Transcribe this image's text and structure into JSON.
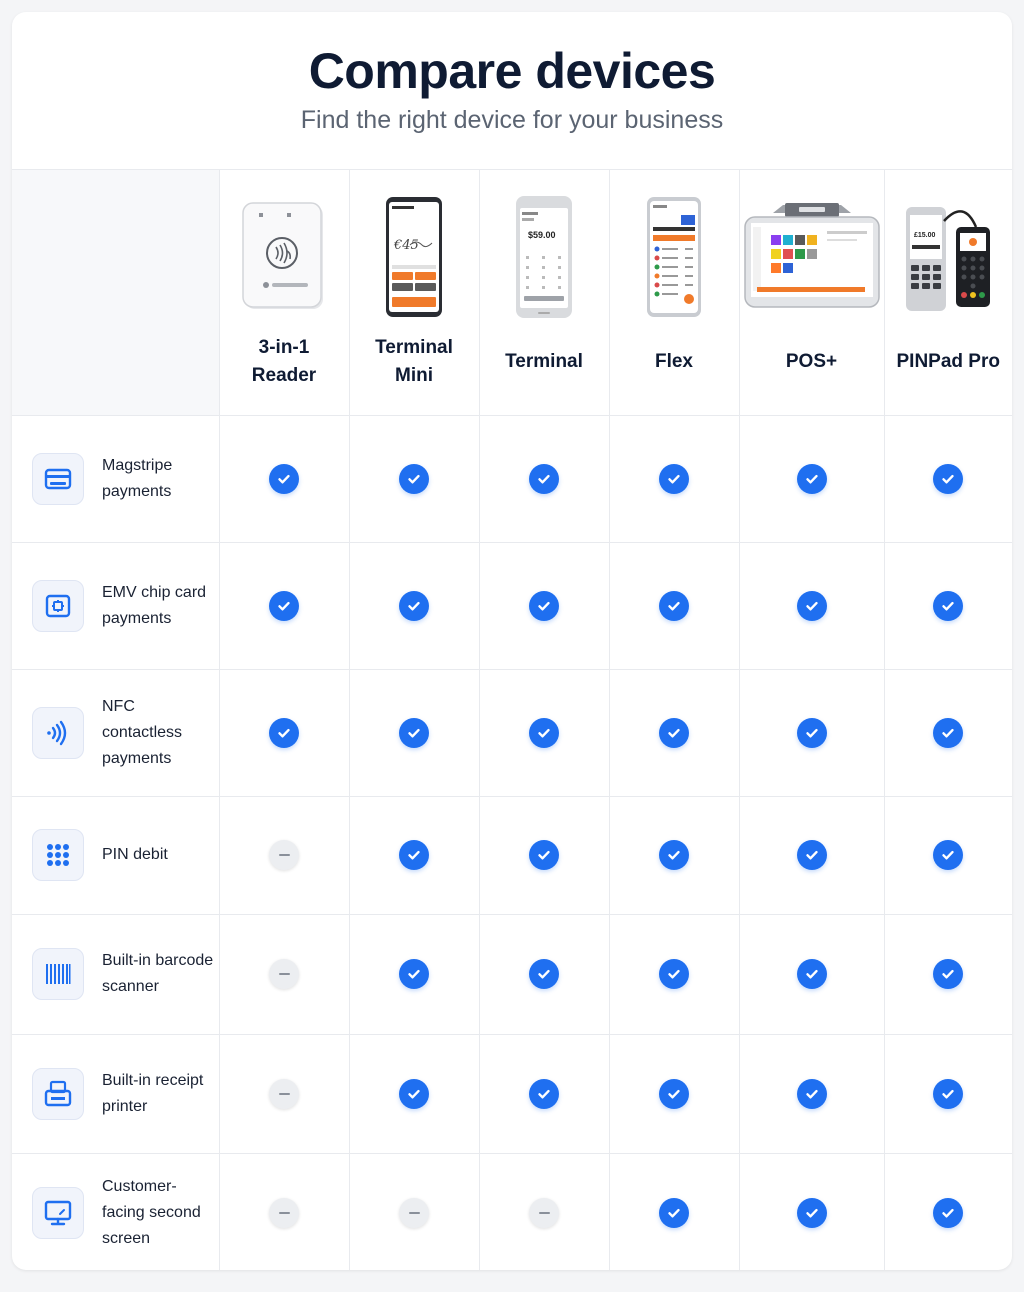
{
  "header": {
    "title": "Compare devices",
    "subtitle": "Find the right device for your business"
  },
  "devices": [
    {
      "name": "3-in-1 Reader",
      "icon": "card-reader-image"
    },
    {
      "name": "Terminal Mini",
      "icon": "terminal-mini-image",
      "screen_text": "€45"
    },
    {
      "name": "Terminal",
      "icon": "terminal-image",
      "screen_text": "$59.00"
    },
    {
      "name": "Flex",
      "icon": "flex-image"
    },
    {
      "name": "POS+",
      "icon": "pos-plus-image"
    },
    {
      "name": "PINPad Pro",
      "icon": "pinpad-pro-image",
      "screen_text": "£15.00"
    }
  ],
  "features": [
    {
      "label": "Magstripe payments",
      "icon": "credit-card-icon",
      "support": [
        true,
        true,
        true,
        true,
        true,
        true
      ]
    },
    {
      "label": "EMV chip card payments",
      "icon": "chip-icon",
      "support": [
        true,
        true,
        true,
        true,
        true,
        true
      ]
    },
    {
      "label": "NFC contactless payments",
      "icon": "contactless-icon",
      "support": [
        true,
        true,
        true,
        true,
        true,
        true
      ]
    },
    {
      "label": "PIN debit",
      "icon": "keypad-icon",
      "support": [
        false,
        true,
        true,
        true,
        true,
        true
      ]
    },
    {
      "label": "Built-in barcode scanner",
      "icon": "barcode-icon",
      "support": [
        false,
        true,
        true,
        true,
        true,
        true
      ]
    },
    {
      "label": "Built-in receipt printer",
      "icon": "printer-icon",
      "support": [
        false,
        true,
        true,
        true,
        true,
        true
      ]
    },
    {
      "label": "Customer-facing second screen",
      "icon": "monitor-icon",
      "support": [
        false,
        false,
        false,
        true,
        true,
        true
      ]
    }
  ],
  "colors": {
    "accent": "#1f6ff0",
    "title": "#0f1b33",
    "subtitle": "#5b6472",
    "unsupported": "#eceef1"
  }
}
